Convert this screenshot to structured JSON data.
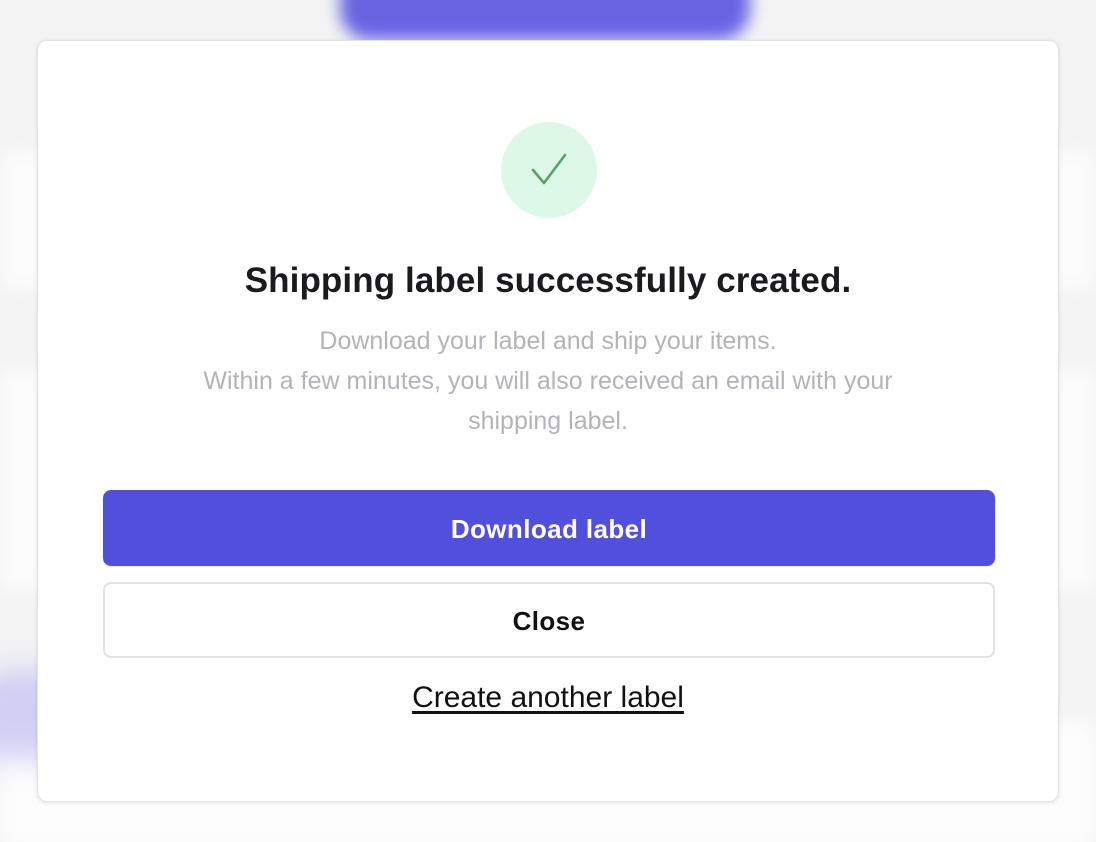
{
  "dialog": {
    "title": "Shipping label successfully created.",
    "description_lines": [
      "Download your label and ship your items.",
      "Within a few minutes, you will also received an email with your",
      "shipping label."
    ],
    "primary_button": "Download label",
    "secondary_button": "Close",
    "link": "Create another label",
    "icon": "check-icon"
  },
  "colors": {
    "primary": "#514fdb",
    "success_bg": "#ddf8e6",
    "success_icon": "#4fa56d",
    "title_text": "#1b1b1f",
    "muted_text": "#b3b3b9"
  }
}
